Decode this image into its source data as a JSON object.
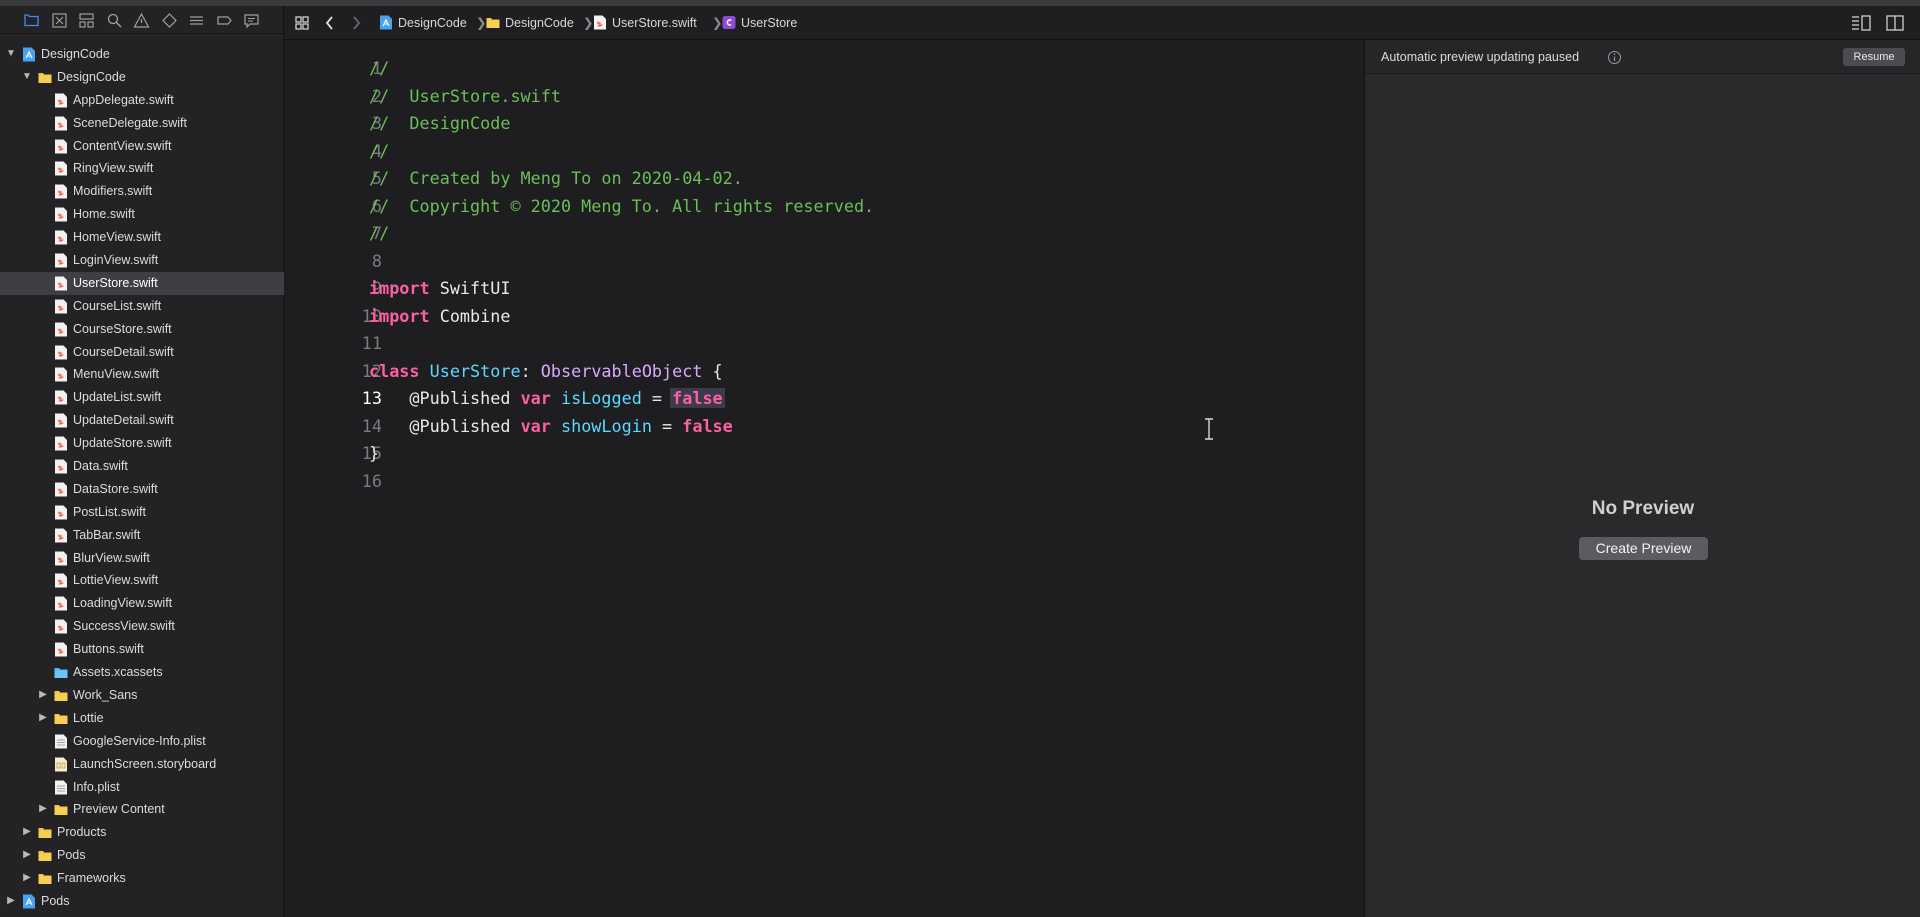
{
  "navigator": {
    "toolbar_icons": [
      "folder-icon",
      "source-control-icon",
      "symbol-icon",
      "find-icon",
      "issue-icon",
      "test-icon",
      "debug-icon",
      "breakpoint-icon",
      "report-icon"
    ],
    "tree": [
      {
        "label": "DesignCode",
        "kind": "project",
        "depth": 0,
        "disclosure": "open"
      },
      {
        "label": "DesignCode",
        "kind": "folder",
        "depth": 1,
        "disclosure": "open"
      },
      {
        "label": "AppDelegate.swift",
        "kind": "swift",
        "depth": 2
      },
      {
        "label": "SceneDelegate.swift",
        "kind": "swift",
        "depth": 2
      },
      {
        "label": "ContentView.swift",
        "kind": "swift",
        "depth": 2
      },
      {
        "label": "RingView.swift",
        "kind": "swift",
        "depth": 2
      },
      {
        "label": "Modifiers.swift",
        "kind": "swift",
        "depth": 2
      },
      {
        "label": "Home.swift",
        "kind": "swift",
        "depth": 2
      },
      {
        "label": "HomeView.swift",
        "kind": "swift",
        "depth": 2
      },
      {
        "label": "LoginView.swift",
        "kind": "swift",
        "depth": 2
      },
      {
        "label": "UserStore.swift",
        "kind": "swift",
        "depth": 2,
        "selected": true
      },
      {
        "label": "CourseList.swift",
        "kind": "swift",
        "depth": 2
      },
      {
        "label": "CourseStore.swift",
        "kind": "swift",
        "depth": 2
      },
      {
        "label": "CourseDetail.swift",
        "kind": "swift",
        "depth": 2
      },
      {
        "label": "MenuView.swift",
        "kind": "swift",
        "depth": 2
      },
      {
        "label": "UpdateList.swift",
        "kind": "swift",
        "depth": 2
      },
      {
        "label": "UpdateDetail.swift",
        "kind": "swift",
        "depth": 2
      },
      {
        "label": "UpdateStore.swift",
        "kind": "swift",
        "depth": 2
      },
      {
        "label": "Data.swift",
        "kind": "swift",
        "depth": 2
      },
      {
        "label": "DataStore.swift",
        "kind": "swift",
        "depth": 2
      },
      {
        "label": "PostList.swift",
        "kind": "swift",
        "depth": 2
      },
      {
        "label": "TabBar.swift",
        "kind": "swift",
        "depth": 2
      },
      {
        "label": "BlurView.swift",
        "kind": "swift",
        "depth": 2
      },
      {
        "label": "LottieView.swift",
        "kind": "swift",
        "depth": 2
      },
      {
        "label": "LoadingView.swift",
        "kind": "swift",
        "depth": 2
      },
      {
        "label": "SuccessView.swift",
        "kind": "swift",
        "depth": 2
      },
      {
        "label": "Buttons.swift",
        "kind": "swift",
        "depth": 2
      },
      {
        "label": "Assets.xcassets",
        "kind": "assets",
        "depth": 2
      },
      {
        "label": "Work_Sans",
        "kind": "folder",
        "depth": 2,
        "disclosure": "closed"
      },
      {
        "label": "Lottie",
        "kind": "folder",
        "depth": 2,
        "disclosure": "closed"
      },
      {
        "label": "GoogleService-Info.plist",
        "kind": "plist",
        "depth": 2
      },
      {
        "label": "LaunchScreen.storyboard",
        "kind": "storyboard",
        "depth": 2
      },
      {
        "label": "Info.plist",
        "kind": "plist",
        "depth": 2
      },
      {
        "label": "Preview Content",
        "kind": "folder",
        "depth": 2,
        "disclosure": "closed"
      },
      {
        "label": "Products",
        "kind": "folder",
        "depth": 1,
        "disclosure": "closed"
      },
      {
        "label": "Pods",
        "kind": "folder",
        "depth": 1,
        "disclosure": "closed"
      },
      {
        "label": "Frameworks",
        "kind": "folder",
        "depth": 1,
        "disclosure": "closed"
      },
      {
        "label": "Pods",
        "kind": "project",
        "depth": 0,
        "disclosure": "closed"
      }
    ]
  },
  "jumpbar": {
    "crumbs": [
      {
        "label": "DesignCode",
        "icon": "project-icon"
      },
      {
        "label": "DesignCode",
        "icon": "folder-icon"
      },
      {
        "label": "UserStore.swift",
        "icon": "swift-file-icon"
      },
      {
        "label": "UserStore",
        "icon": "class-icon"
      }
    ]
  },
  "editor": {
    "current_line": 13,
    "lines": [
      [
        [
          "cm",
          "//"
        ]
      ],
      [
        [
          "cm",
          "//  UserStore.swift"
        ]
      ],
      [
        [
          "cm",
          "//  DesignCode"
        ]
      ],
      [
        [
          "cm",
          "//"
        ]
      ],
      [
        [
          "cm",
          "//  Created by Meng To on 2020-04-02."
        ]
      ],
      [
        [
          "cm",
          "//  Copyright © 2020 Meng To. All rights reserved."
        ]
      ],
      [
        [
          "cm",
          "//"
        ]
      ],
      [],
      [
        [
          "kw",
          "import"
        ],
        [
          "pl",
          " SwiftUI"
        ]
      ],
      [
        [
          "kw",
          "import"
        ],
        [
          "pl",
          " Combine"
        ]
      ],
      [],
      [
        [
          "kw",
          "class"
        ],
        [
          "pl",
          " "
        ],
        [
          "nm",
          "UserStore"
        ],
        [
          "pl",
          ": "
        ],
        [
          "ty",
          "ObservableObject"
        ],
        [
          "pl",
          " {"
        ]
      ],
      [
        [
          "pl",
          "    "
        ],
        [
          "at",
          "@Published"
        ],
        [
          "pl",
          " "
        ],
        [
          "kw",
          "var"
        ],
        [
          "pl",
          " "
        ],
        [
          "nm",
          "isLogged"
        ],
        [
          "pl",
          " = "
        ],
        [
          "kw hl",
          "false"
        ]
      ],
      [
        [
          "pl",
          "    "
        ],
        [
          "at",
          "@Published"
        ],
        [
          "pl",
          " "
        ],
        [
          "kw",
          "var"
        ],
        [
          "pl",
          " "
        ],
        [
          "nm",
          "showLogin"
        ],
        [
          "pl",
          " = "
        ],
        [
          "kw",
          "false"
        ]
      ],
      [
        [
          "pl",
          "}"
        ]
      ],
      []
    ]
  },
  "canvas": {
    "paused_text": "Automatic preview updating paused",
    "resume_label": "Resume",
    "no_preview_text": "No Preview",
    "create_preview_label": "Create Preview"
  },
  "colors": {
    "comment": "#6bbf59",
    "keyword": "#fc5fa3",
    "type": "#d9a9ff",
    "declaration": "#5dd8ff",
    "folder": "#f5c542",
    "project": "#4aa3f0"
  }
}
